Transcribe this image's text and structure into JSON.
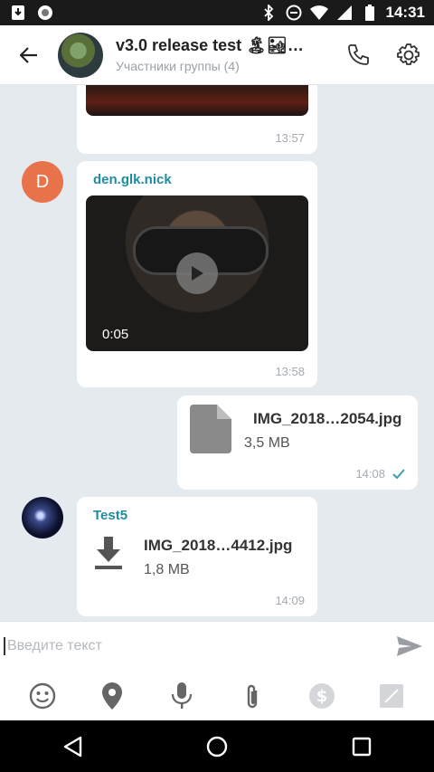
{
  "statusbar": {
    "time": "14:31"
  },
  "header": {
    "title": "v3.0 release test 🏝🏜🏔 …",
    "subtitle": "Участники группы (4)"
  },
  "messages": [
    {
      "type": "photo",
      "time": "13:57"
    },
    {
      "type": "video",
      "sender": "den.glk.nick",
      "avatar_letter": "D",
      "avatar_color": "#e8734a",
      "duration": "0:05",
      "time": "13:58"
    },
    {
      "type": "file",
      "outgoing": true,
      "file_name": "IMG_2018…2054.jpg",
      "file_size": "3,5 MB",
      "time": "14:08",
      "status": "sent"
    },
    {
      "type": "file",
      "sender": "Test5",
      "file_name": "IMG_2018…4412.jpg",
      "file_size": "1,8 MB",
      "time": "14:09"
    }
  ],
  "composer": {
    "placeholder": "Введите текст",
    "tools": [
      "emoji-icon",
      "location-icon",
      "microphone-icon",
      "attachment-icon",
      "money-icon",
      "sticker-icon"
    ]
  },
  "colors": {
    "accent": "#1f8da0",
    "chat_bg": "#e5eaef",
    "check": "#3aa0a8"
  }
}
